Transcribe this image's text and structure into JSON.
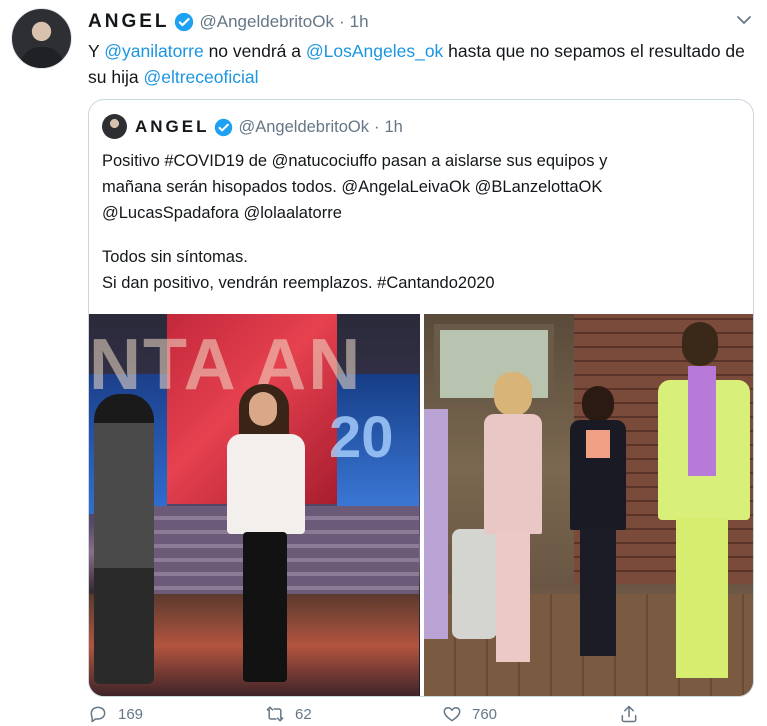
{
  "tweet": {
    "author": {
      "name": "ANGEL",
      "handle": "@AngeldebritoOk",
      "separator": "·",
      "time": "1h"
    },
    "text": {
      "part1": "Y ",
      "mention1": "@yanilatorre",
      "part2": " no vendrá a ",
      "mention2": "@LosAngeles_ok",
      "part3": " hasta que no sepamos el resultado de su hija ",
      "mention3": "@eltreceoficial"
    },
    "quoted": {
      "author": {
        "name": "ANGEL",
        "handle": "@AngeldebritoOk",
        "separator": "·",
        "time": "1h"
      },
      "lines": [
        "Positivo #COVID19 de @natucociuffo pasan a aislarse sus equipos y",
        "mañana serán hisopados todos. @AngelaLeivaOk @BLanzelottaOK",
        " @LucasSpadafora @lolaalatorre",
        "Todos sin síntomas.",
        "Si dan positivo, vendrán reemplazos.  #Cantando2020"
      ],
      "photo1_text": {
        "letters": "NTA   AN",
        "year": "20"
      }
    },
    "actions": {
      "replies": "169",
      "retweets": "62",
      "likes": "760"
    }
  },
  "colors": {
    "link": "#1b95e0",
    "secondary_text": "#657786",
    "verified": "#1da1f2",
    "border": "#ccd6dd"
  }
}
